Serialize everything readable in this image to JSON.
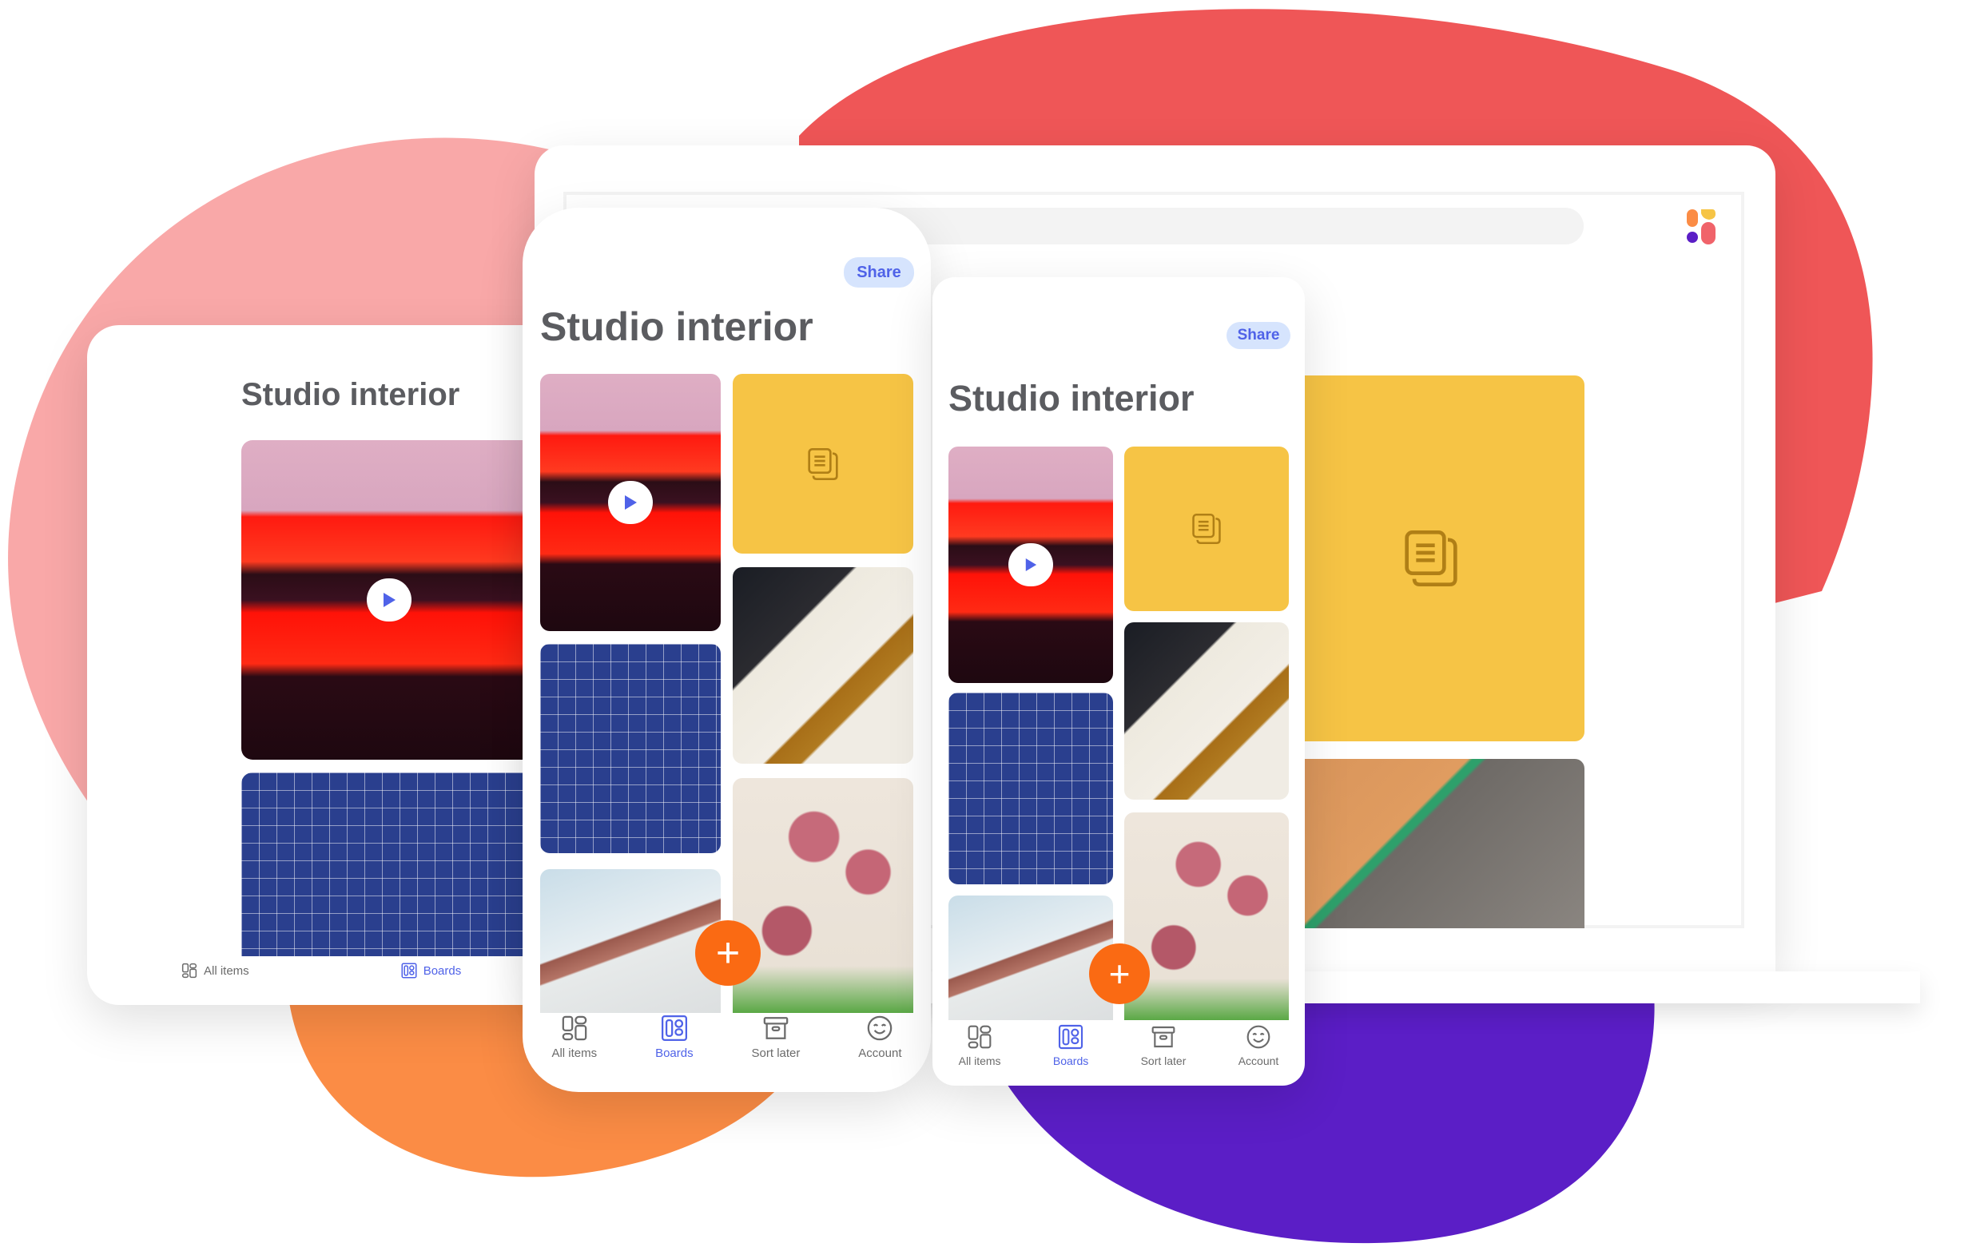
{
  "board": {
    "title": "Studio interior",
    "share_label": "Share"
  },
  "nav": {
    "items": [
      {
        "label": "All items",
        "icon": "all-items-icon",
        "active": false
      },
      {
        "label": "Boards",
        "icon": "boards-icon",
        "active": true
      },
      {
        "label": "Sort later",
        "icon": "archive-box-icon",
        "active": false
      },
      {
        "label": "Account",
        "icon": "smiley-face-icon",
        "active": false
      }
    ]
  },
  "fab": {
    "label": "+"
  },
  "colors": {
    "accent": "#4f62e8",
    "share_bg": "#d6e4fd",
    "note_tile": "#f6c445",
    "fab": "#fa6a13",
    "blob_red": "#ef5657",
    "blob_pink": "#f9a8a8",
    "blob_orange": "#fb8c45",
    "blob_purple": "#5b1ec6",
    "title_text": "#5b5c60"
  },
  "tiles": [
    {
      "type": "video",
      "icon": "play-icon"
    },
    {
      "type": "note",
      "icon": "notes-icon"
    },
    {
      "type": "photo"
    },
    {
      "type": "photo"
    },
    {
      "type": "photo"
    },
    {
      "type": "photo"
    }
  ]
}
